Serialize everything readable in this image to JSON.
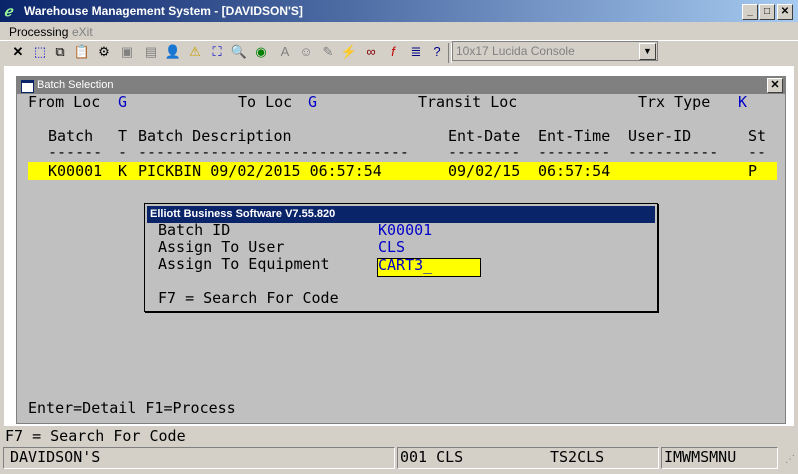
{
  "window": {
    "title": "Warehouse Management System - [DAVIDSON'S]",
    "min_label": "_",
    "max_label": "□",
    "close_label": "✕"
  },
  "menu": {
    "items": [
      "Processing",
      "eXit"
    ]
  },
  "toolbar": {
    "font_selector": "10x17 Lucida Console",
    "dropdown_glyph": "▼"
  },
  "batch_window": {
    "title": "Batch Selection",
    "close_label": "✕",
    "from_loc_label": "From Loc",
    "from_loc_value": "G",
    "to_loc_label": "To Loc",
    "to_loc_value": "G",
    "transit_loc_label": "Transit Loc",
    "trx_type_label": "Trx Type",
    "trx_type_value": "K",
    "columns": [
      "Batch",
      "T",
      "Batch Description",
      "Ent-Date",
      "Ent-Time",
      "User-ID",
      "St"
    ],
    "dashes": [
      "------",
      "-",
      "------------------------------",
      "--------",
      "--------",
      "----------",
      "--"
    ],
    "rows": [
      {
        "batch": "K00001",
        "t": "K",
        "description": "PICKBIN 09/02/2015 06:57:54",
        "ent_date": "09/02/15",
        "ent_time": "06:57:54",
        "user_id": "",
        "st": "P"
      }
    ],
    "footer": "Enter=Detail F1=Process"
  },
  "dialog": {
    "title": "Elliott Business Software V7.55.820",
    "batch_id_label": "Batch ID",
    "batch_id_value": "K00001",
    "assign_user_label": "Assign To User",
    "assign_user_value": "CLS",
    "assign_equipment_label": "Assign To Equipment",
    "assign_equipment_value": "CART3_",
    "hint": "F7 = Search For Code"
  },
  "status": {
    "message": "F7 = Search For Code",
    "company": "DAVIDSON'S",
    "user": "001 CLS",
    "terminal": "TS2CLS",
    "program": "IMWMSMNU"
  }
}
